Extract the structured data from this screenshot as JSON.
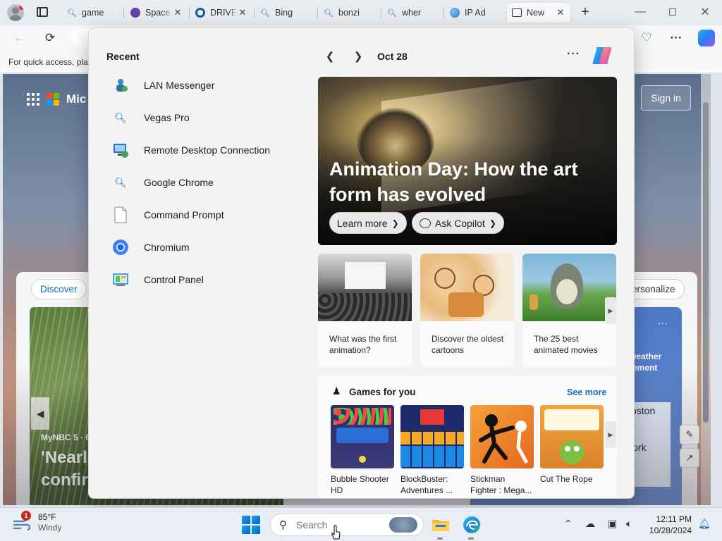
{
  "browser": {
    "tabs": [
      {
        "title": "game",
        "icon": "search-icon"
      },
      {
        "title": "Space",
        "icon": "twitch-icon"
      },
      {
        "title": "DRIVE",
        "icon": "drive-icon"
      },
      {
        "title": "Bing",
        "icon": "search-icon"
      },
      {
        "title": "bonzi",
        "icon": "search-icon"
      },
      {
        "title": "wher",
        "icon": "search-icon"
      },
      {
        "title": "IP Ad",
        "icon": "globe-icon"
      },
      {
        "title": "New",
        "icon": "newtab-icon"
      }
    ],
    "favorites_bar_text": "For quick access, plac"
  },
  "ntp": {
    "brand_partial": "Mic",
    "sign_in": "Sign in",
    "discover": "Discover",
    "personalize": "ersonalize",
    "news": {
      "source": "MyNBC 5 · 6",
      "headline": "'Nearl\nconfir"
    },
    "weather": {
      "more": "···",
      "text": "weather\ntement",
      "map_text1": "oston",
      "map_text2": "ork"
    }
  },
  "flyout": {
    "recent_title": "Recent",
    "recent": [
      {
        "label": "LAN Messenger",
        "icon": "lan-messenger-icon"
      },
      {
        "label": "Vegas Pro",
        "icon": "search-icon"
      },
      {
        "label": "Remote Desktop Connection",
        "icon": "remote-desktop-icon"
      },
      {
        "label": "Google Chrome",
        "icon": "search-icon"
      },
      {
        "label": "Command Prompt",
        "icon": "file-icon"
      },
      {
        "label": "Chromium",
        "icon": "chromium-icon"
      },
      {
        "label": "Control Panel",
        "icon": "control-panel-icon"
      }
    ],
    "date": "Oct 28",
    "more": "···",
    "hero": {
      "headline": "Animation Day: How the art form has evolved",
      "learn_more": "Learn more",
      "ask_copilot": "Ask Copilot"
    },
    "cards": [
      {
        "caption": "What was the first animation?"
      },
      {
        "caption": "Discover the oldest cartoons"
      },
      {
        "caption": "The 25 best animated movies"
      }
    ],
    "games": {
      "title": "Games for you",
      "see_more": "See more",
      "items": [
        {
          "name": "Bubble Shooter HD"
        },
        {
          "name": "BlockBuster: Adventures ..."
        },
        {
          "name": "Stickman Fighter : Mega..."
        },
        {
          "name": "Cut The Rope"
        }
      ]
    }
  },
  "taskbar": {
    "weather": {
      "temp": "85°F",
      "condition": "Windy",
      "badge": "1"
    },
    "search_placeholder": "Search",
    "time": "12:11 PM",
    "date": "10/28/2024"
  }
}
